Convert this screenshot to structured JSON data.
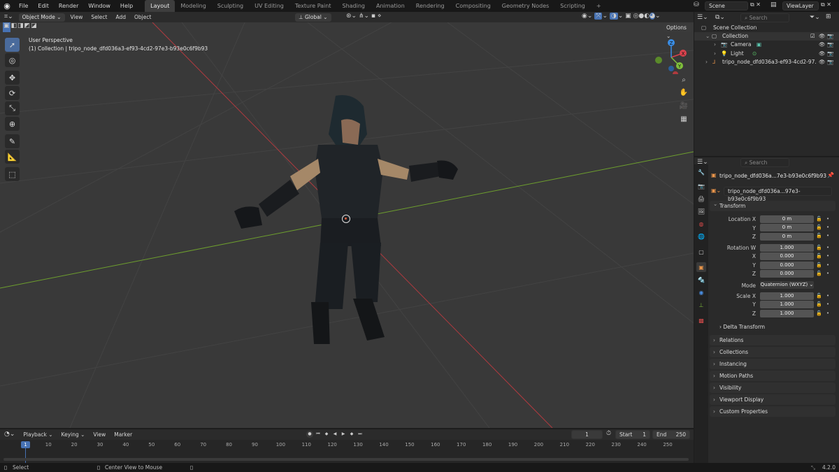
{
  "menu": [
    "File",
    "Edit",
    "Render",
    "Window",
    "Help"
  ],
  "workspaces": [
    "Layout",
    "Modeling",
    "Sculpting",
    "UV Editing",
    "Texture Paint",
    "Shading",
    "Animation",
    "Rendering",
    "Compositing",
    "Geometry Nodes",
    "Scripting"
  ],
  "add_workspace": "+",
  "scene": "Scene",
  "view_layer": "ViewLayer",
  "viewport_header": {
    "mode": "Object Mode",
    "items": [
      "View",
      "Select",
      "Add",
      "Object"
    ],
    "orientation": "Global",
    "options": "Options"
  },
  "viewport_overlay": {
    "line1": "User Perspective",
    "line2": "(1) Collection | tripo_node_dfd036a3-ef93-4cd2-97e3-b93e0c6f9b93"
  },
  "gizmo": {
    "x": "X",
    "y": "Y",
    "z": "Z"
  },
  "outliner": {
    "search_placeholder": "Search",
    "scene_collection": "Scene Collection",
    "collection": "Collection",
    "camera": "Camera",
    "light": "Light",
    "object": "tripo_node_dfd036a3-ef93-4cd2-97..."
  },
  "properties": {
    "search_placeholder": "Search",
    "object_name": "tripo_node_dfd036a...7e3-b93e0c6f9b93",
    "datablock_name": "tripo_node_dfd036a...97e3-b93e0c6f9b93",
    "transform_label": "Transform",
    "location_x_label": "Location X",
    "y_label": "Y",
    "z_label": "Z",
    "rotation_w_label": "Rotation W",
    "x_label": "X",
    "mode_label": "Mode",
    "scale_x_label": "Scale X",
    "location": [
      "0 m",
      "0 m",
      "0 m"
    ],
    "rotation": [
      "1.000",
      "0.000",
      "0.000",
      "0.000"
    ],
    "rotation_mode": "Quaternion (WXYZ)",
    "scale": [
      "1.000",
      "1.000",
      "1.000"
    ],
    "delta_transform": "Delta Transform",
    "panels": [
      "Relations",
      "Collections",
      "Instancing",
      "Motion Paths",
      "Visibility",
      "Viewport Display",
      "Custom Properties"
    ]
  },
  "timeline": {
    "menu": [
      "Playback",
      "Keying",
      "View",
      "Marker"
    ],
    "current_frame": "1",
    "start_label": "Start",
    "start": "1",
    "end_label": "End",
    "end": "250",
    "ticks": [
      "1",
      "10",
      "20",
      "30",
      "40",
      "50",
      "60",
      "70",
      "80",
      "90",
      "100",
      "110",
      "120",
      "130",
      "140",
      "150",
      "160",
      "170",
      "180",
      "190",
      "200",
      "210",
      "220",
      "230",
      "240",
      "250"
    ]
  },
  "status": {
    "select": "Select",
    "center_view": "Center View to Mouse",
    "version": "4.2.0"
  },
  "colors": {
    "accent": "#4772b3",
    "x_axis": "#d9424d",
    "y_axis": "#7fbf3b",
    "z_axis": "#3a8ee6",
    "active_tool": "#4a6b9c"
  }
}
